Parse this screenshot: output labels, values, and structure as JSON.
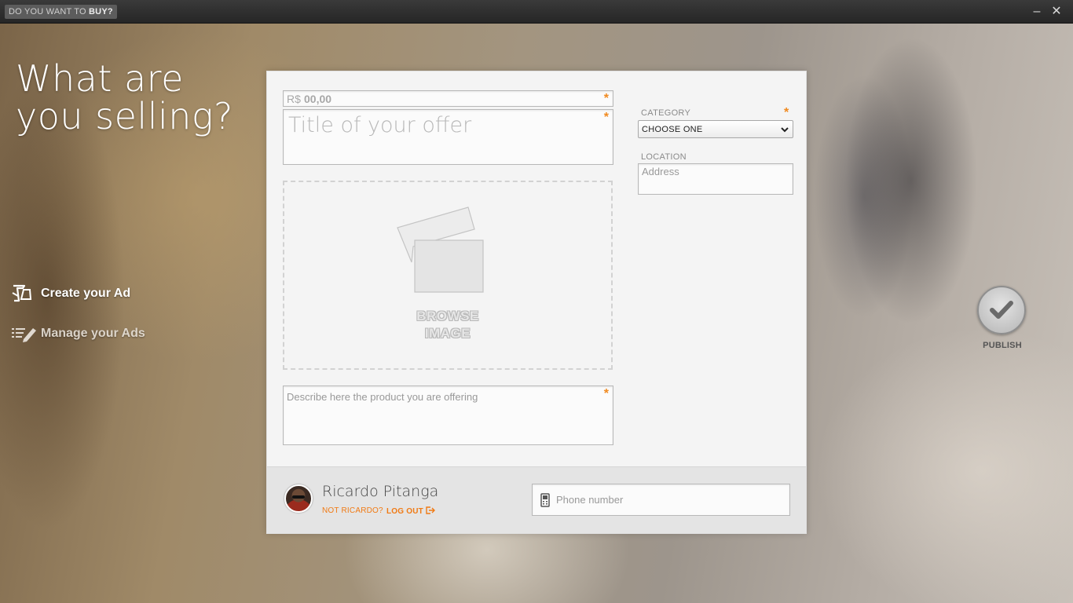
{
  "titlebar": {
    "buy_prefix": "DO YOU WANT TO ",
    "buy_strong": "BUY?",
    "minimize": "–",
    "close": "✕"
  },
  "headline": {
    "line1": "What are",
    "line2": "you selling?"
  },
  "nav": {
    "items": [
      {
        "label": "Create your Ad",
        "icon": "tablet-hand-icon",
        "active": true
      },
      {
        "label": "Manage your Ads",
        "icon": "list-pencil-icon",
        "active": false
      }
    ]
  },
  "form": {
    "price": {
      "currency": "R$",
      "placeholder": "00,00",
      "required_mark": "*"
    },
    "title": {
      "placeholder": "Title of your offer",
      "required_mark": "*"
    },
    "image": {
      "label_line1": "BROWSE",
      "label_line2": "IMAGE"
    },
    "description": {
      "placeholder": "Describe here the product you are offering",
      "required_mark": "*"
    },
    "category": {
      "label": "CATEGORY",
      "value": "CHOOSE ONE",
      "required_mark": "*"
    },
    "location": {
      "label": "LOCATION",
      "placeholder": "Address"
    },
    "phone": {
      "placeholder": "Phone number"
    }
  },
  "user": {
    "name": "Ricardo Pitanga",
    "not_user": "NOT RICARDO?",
    "logout": "LOG OUT"
  },
  "publish": {
    "label": "PUBLISH"
  },
  "colors": {
    "accent": "#f07a14",
    "required": "#f08a20",
    "panel": "#f4f4f4"
  }
}
